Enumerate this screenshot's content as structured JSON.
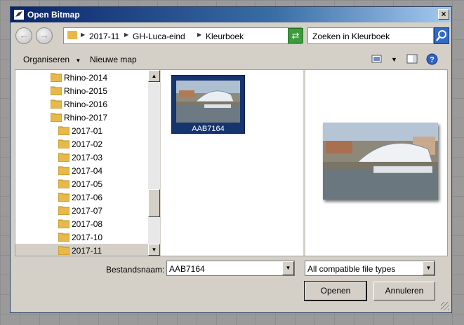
{
  "window": {
    "title": "Open Bitmap",
    "close_label": "×"
  },
  "address": {
    "back": "←",
    "forward": "→",
    "crumbs": [
      "2017-11",
      "GH-Luca-eind",
      "Kleurboek"
    ],
    "refresh": "⇄",
    "search_placeholder": "Zoeken in Kleurboek"
  },
  "toolbar": {
    "organize": "Organiseren",
    "new_folder": "Nieuwe map"
  },
  "tree": {
    "items": [
      "Rhino-2014",
      "Rhino-2015",
      "Rhino-2016",
      "Rhino-2017",
      "2017-01",
      "2017-02",
      "2017-03",
      "2017-04",
      "2017-05",
      "2017-06",
      "2017-07",
      "2017-08",
      "2017-10",
      "2017-11"
    ],
    "selected": "2017-11"
  },
  "files": [
    {
      "name": "AAB7164"
    }
  ],
  "bottom": {
    "filename_label": "Bestandsnaam:",
    "filename_value": "AAB7164",
    "filetype_value": "All compatible file types",
    "open_label": "Openen",
    "cancel_label": "Annuleren"
  },
  "colors": {
    "title_bar": "#0a246a",
    "selected_tile": "#16346e",
    "folder": "#e7b84a"
  }
}
